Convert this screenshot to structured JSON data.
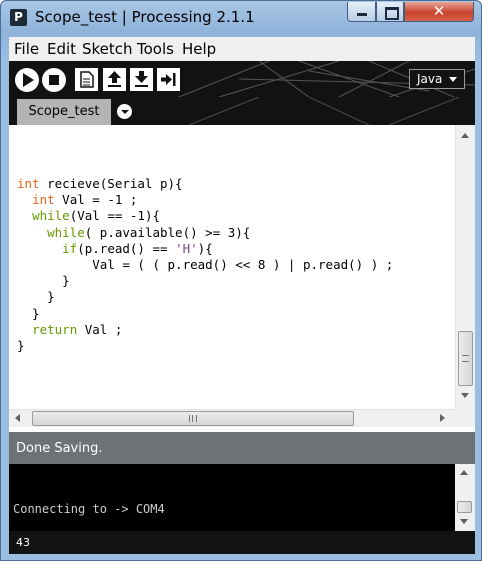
{
  "window": {
    "icon_letter": "P",
    "title": "Scope_test | Processing 2.1.1",
    "close_glyph": "✕"
  },
  "menu": [
    "File",
    "Edit",
    "Sketch",
    "Tools",
    "Help"
  ],
  "toolbar": {
    "buttons": [
      "run-icon",
      "stop-icon",
      "new-icon",
      "open-icon",
      "save-icon",
      "export-icon"
    ],
    "mode": "Java"
  },
  "tabs": [
    {
      "label": "Scope_test",
      "active": true
    }
  ],
  "code": {
    "line1_type": "int",
    "line1_rest": " recieve(Serial p){",
    "line2_indent": "  ",
    "line2_type": "int",
    "line2_rest": " Val = -1 ;",
    "line3_indent": "  ",
    "line3_kw": "while",
    "line3_rest": "(Val == -1){",
    "line4_indent": "    ",
    "line4_kw": "while",
    "line4_rest": "( p.available() >= 3){",
    "line5_indent": "      ",
    "line5_kw": "if",
    "line5_mid": "(p.read() == ",
    "line5_str": "'H'",
    "line5_end": "){",
    "line6": "          Val = ( ( p.read() << 8 ) | p.read() ) ;",
    "line7": "      }",
    "line8": "    }",
    "line9": "  }",
    "line10_indent": "  ",
    "line10_kw": "return",
    "line10_rest": " Val ;",
    "line11": "}"
  },
  "status": {
    "message": "Done Saving."
  },
  "console": {
    "line": "Connecting to -> COM4"
  },
  "footer": {
    "line_number": "43"
  },
  "colors": {
    "keyword_type": "#e2661a",
    "keyword_control": "#669900",
    "string": "#7d4793",
    "toolbar_bg": "#121212",
    "status_bg": "#6e7275"
  }
}
